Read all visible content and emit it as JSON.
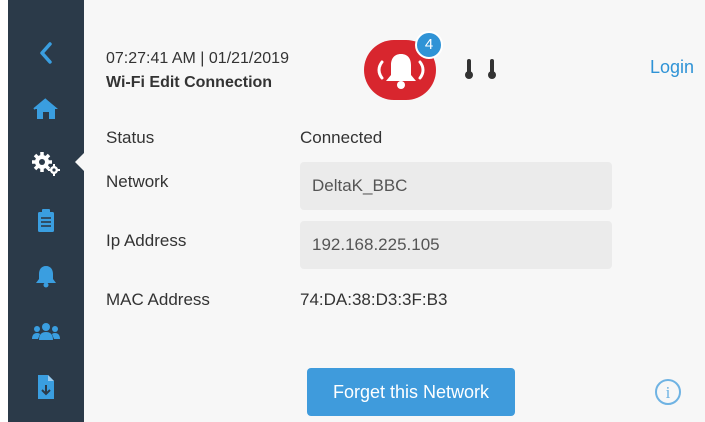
{
  "header": {
    "datetime": "07:27:41 AM | 01/21/2019",
    "title": "Wi-Fi Edit Connection",
    "alarm_count": "4",
    "login_label": "Login"
  },
  "sidebar": {
    "items": [
      {
        "icon": "back-chevron-icon"
      },
      {
        "icon": "home-icon"
      },
      {
        "icon": "settings-gears-icon",
        "active": true
      },
      {
        "icon": "clipboard-icon"
      },
      {
        "icon": "bell-icon"
      },
      {
        "icon": "users-icon"
      },
      {
        "icon": "file-download-icon"
      }
    ]
  },
  "connection": {
    "status_label": "Status",
    "status_value": "Connected",
    "network_label": "Network",
    "network_value": "DeltaK_BBC",
    "ip_label": "Ip Address",
    "ip_value": "192.168.225.105",
    "mac_label": "MAC Address",
    "mac_value": "74:DA:38:D3:3F:B3"
  },
  "actions": {
    "forget_label": "Forget this Network",
    "info_glyph": "i"
  },
  "colors": {
    "sidebar": "#2b3a49",
    "sidebar_icon": "#3a9ee0",
    "alarm": "#d8262e",
    "accent": "#2f93d6",
    "button": "#3f9bdc"
  }
}
